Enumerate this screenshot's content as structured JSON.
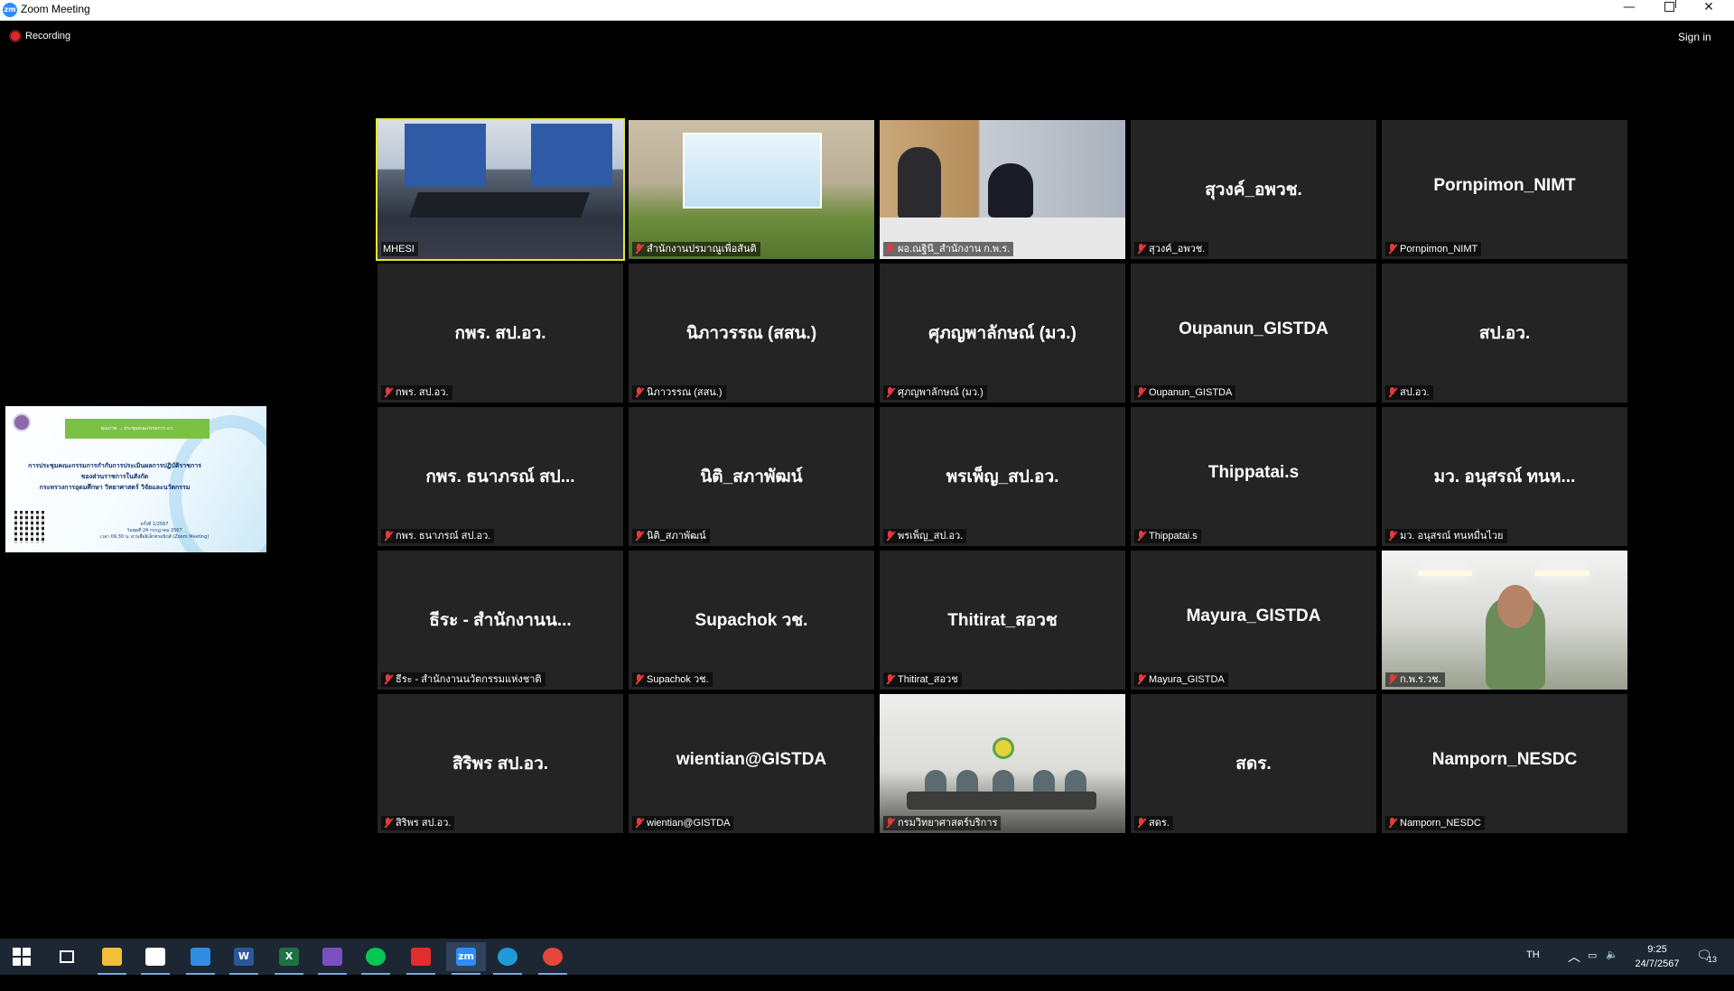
{
  "window": {
    "title": "Zoom Meeting",
    "logo_text": "zm",
    "minimize": "—",
    "close": "✕"
  },
  "meeting": {
    "recording_label": "Recording",
    "sign_in_label": "Sign in"
  },
  "shared_screen": {
    "banner_text": "คุณภาพ ... ประชุมคณะกรรมการ อว.",
    "heading_lines": [
      "การประชุมคณะกรรมการกำกับการประเมินผลการปฏิบัติราชการ",
      "ของส่วนราชการในสังกัด",
      "กระทรวงการอุดมศึกษา วิทยาศาสตร์ วิจัยและนวัตกรรม"
    ],
    "detail_lines": [
      "ครั้งที่ 1/2567",
      "วันพุธที่ 24 กรกฎาคม 2567",
      "เวลา 09.30 น. ผ่านสื่ออิเล็กทรอนิกส์ (Zoom Meeting)"
    ]
  },
  "participants": [
    {
      "display": "",
      "label": "MHESI",
      "video": "v1",
      "active": true,
      "muted": false
    },
    {
      "display": "",
      "label": "สำนักงานปรมาณูเพื่อสันติ",
      "video": "v2",
      "active": false,
      "muted": true
    },
    {
      "display": "",
      "label": "ผอ.ณฐินี_สำนักงาน ก.พ.ร.",
      "video": "v3",
      "active": false,
      "muted": true
    },
    {
      "display": "สุวงค์_อพวช.",
      "label": "สุวงค์_อพวช.",
      "video": "",
      "active": false,
      "muted": true
    },
    {
      "display": "Pornpimon_NIMT",
      "label": "Pornpimon_NIMT",
      "video": "",
      "active": false,
      "muted": true
    },
    {
      "display": "กพร. สป.อว.",
      "label": "กพร. สป.อว.",
      "video": "",
      "active": false,
      "muted": true
    },
    {
      "display": "นิภาวรรณ (สสน.)",
      "label": "นิภาวรรณ (สสน.)",
      "video": "",
      "active": false,
      "muted": true
    },
    {
      "display": "ศุภญพาลักษณ์ (มว.)",
      "label": "ศุภญพาลักษณ์ (มว.)",
      "video": "",
      "active": false,
      "muted": true
    },
    {
      "display": "Oupanun_GISTDA",
      "label": "Oupanun_GISTDA",
      "video": "",
      "active": false,
      "muted": true
    },
    {
      "display": "สป.อว.",
      "label": "สป.อว.",
      "video": "",
      "active": false,
      "muted": true
    },
    {
      "display": "กพร. ธนาภรณ์ สป...",
      "label": "กพร. ธนาภรณ์ สป.อว.",
      "video": "",
      "active": false,
      "muted": true
    },
    {
      "display": "นิติ_สภาพัฒน์",
      "label": "นิติ_สภาพัฒน์",
      "video": "",
      "active": false,
      "muted": true
    },
    {
      "display": "พรเพ็ญ_สป.อว.",
      "label": "พรเพ็ญ_สป.อว.",
      "video": "",
      "active": false,
      "muted": true
    },
    {
      "display": "Thippatai.s",
      "label": "Thippatai.s",
      "video": "",
      "active": false,
      "muted": true
    },
    {
      "display": "มว. อนุสรณ์ ทนห...",
      "label": "มว. อนุสรณ์ ทนหมื่นไวย",
      "video": "",
      "active": false,
      "muted": true
    },
    {
      "display": "ธีระ - สำนักงานน...",
      "label": "ธีระ - สำนักงานนวัตกรรมแห่งชาติ",
      "video": "",
      "active": false,
      "muted": true
    },
    {
      "display": "Supachok วช.",
      "label": "Supachok วช.",
      "video": "",
      "active": false,
      "muted": true
    },
    {
      "display": "Thitirat_สอวช",
      "label": "Thitirat_สอวช",
      "video": "",
      "active": false,
      "muted": true
    },
    {
      "display": "Mayura_GISTDA",
      "label": "Mayura_GISTDA",
      "video": "",
      "active": false,
      "muted": true
    },
    {
      "display": "",
      "label": "ก.พ.ร.วช.",
      "video": "v4",
      "active": false,
      "muted": true
    },
    {
      "display": "สิริพร สป.อว.",
      "label": "สิริพร สป.อว.",
      "video": "",
      "active": false,
      "muted": true
    },
    {
      "display": "wientian@GISTDA",
      "label": "wientian@GISTDA",
      "video": "",
      "active": false,
      "muted": true
    },
    {
      "display": "",
      "label": "กรมวิทยาศาสตร์บริการ",
      "video": "v5",
      "active": false,
      "muted": true
    },
    {
      "display": "สดร.",
      "label": "สดร.",
      "video": "",
      "active": false,
      "muted": true
    },
    {
      "display": "Namporn_NESDC",
      "label": "Namporn_NESDC",
      "video": "",
      "active": false,
      "muted": true
    }
  ],
  "taskbar": {
    "apps": [
      {
        "name": "start-button",
        "icon": "windows-icon",
        "color": "#ffffff"
      },
      {
        "name": "task-view-button",
        "icon": "task-view-icon",
        "color": "#ffffff"
      },
      {
        "name": "file-explorer-button",
        "icon": "folder-icon",
        "color": "#f2c038"
      },
      {
        "name": "microsoft-store-button",
        "icon": "store-icon",
        "color": "#ffffff"
      },
      {
        "name": "mail-button",
        "icon": "mail-icon",
        "color": "#2f8de4"
      },
      {
        "name": "word-button",
        "icon": "word-icon",
        "color": "#2b579a",
        "text": "W"
      },
      {
        "name": "excel-button",
        "icon": "excel-icon",
        "color": "#1e7145",
        "text": "X"
      },
      {
        "name": "onenote-button",
        "icon": "onenote-icon",
        "color": "#7a4fc0"
      },
      {
        "name": "line-button",
        "icon": "line-icon",
        "color": "#06c755"
      },
      {
        "name": "pdf-reader-button",
        "icon": "pdf-icon",
        "color": "#e02d2d"
      },
      {
        "name": "zoom-button",
        "icon": "zoom-icon",
        "color": "#2d8cff",
        "text": "zm"
      },
      {
        "name": "edge-button",
        "icon": "edge-icon",
        "color": "#1f9bd7"
      },
      {
        "name": "chrome-button",
        "icon": "chrome-icon",
        "color": "#e8453c"
      }
    ],
    "language": "TH",
    "time": "9:25",
    "date": "24/7/2567",
    "notification_count": "13"
  }
}
